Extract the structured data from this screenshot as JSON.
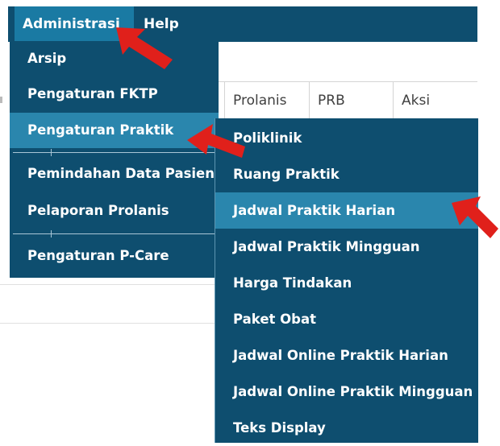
{
  "menubar": {
    "items": [
      "Administrasi",
      "Help"
    ]
  },
  "table": {
    "columns": [
      "Prolanis",
      "PRB",
      "Aksi"
    ]
  },
  "dropdown": {
    "items": [
      "Arsip",
      "Pengaturan FKTP",
      "Pengaturan Praktik",
      "Pemindahan Data Pasien",
      "Pelaporan Prolanis",
      "Pengaturan P-Care"
    ],
    "active_index": 2
  },
  "submenu": {
    "items": [
      "Poliklinik",
      "Ruang Praktik",
      "Jadwal Praktik Harian",
      "Jadwal Praktik Mingguan",
      "Harga Tindakan",
      "Paket Obat",
      "Jadwal Online Praktik Harian",
      "Jadwal Online Praktik Mingguan",
      "Teks Display"
    ],
    "active_index": 2
  },
  "colors": {
    "menu_bg": "#0e4e6f",
    "menu_active": "#2a86ad",
    "arrow": "#e0201b"
  }
}
